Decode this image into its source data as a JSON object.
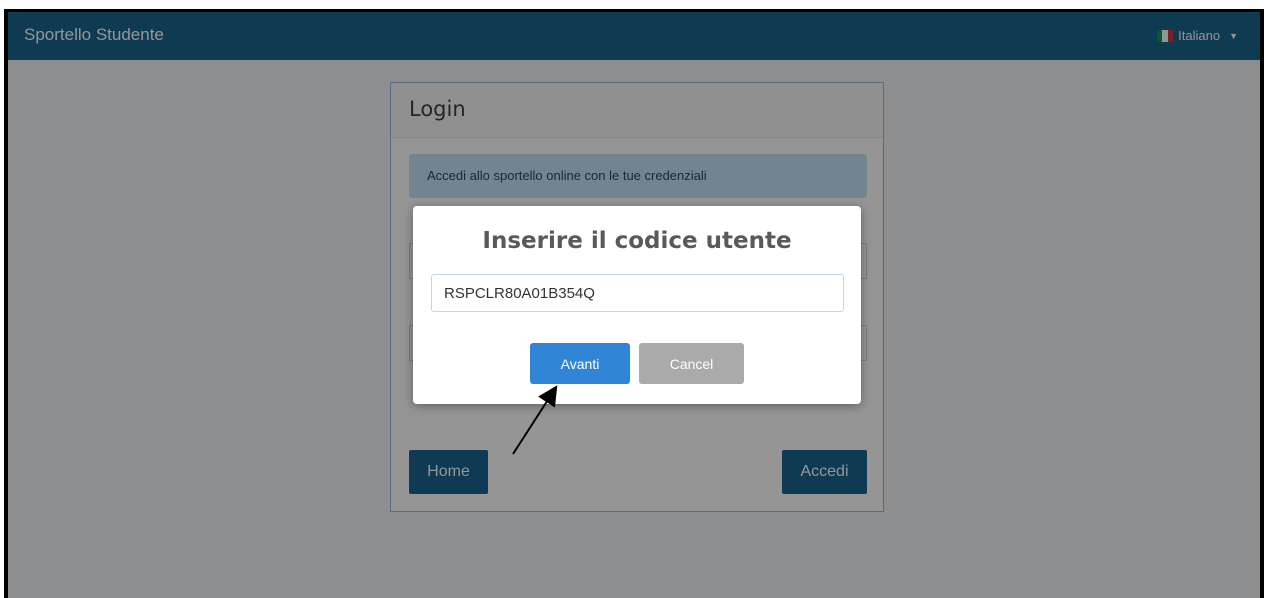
{
  "navbar": {
    "brand": "Sportello Studente",
    "language": "Italiano",
    "flag_colors": [
      "#009246",
      "#ffffff",
      "#ce2b37"
    ]
  },
  "login_panel": {
    "title": "Login",
    "info_message": "Accedi allo sportello online con le tue credenziali",
    "home_label": "Home",
    "accedi_label": "Accedi"
  },
  "dialog": {
    "title": "Inserire il codice utente",
    "input_value": "RSPCLR80A01B354Q",
    "confirm_label": "Avanti",
    "cancel_label": "Cancel"
  },
  "colors": {
    "navbar": "#0a5a86",
    "confirm": "#3085d6",
    "cancel": "#aaaaaa"
  }
}
